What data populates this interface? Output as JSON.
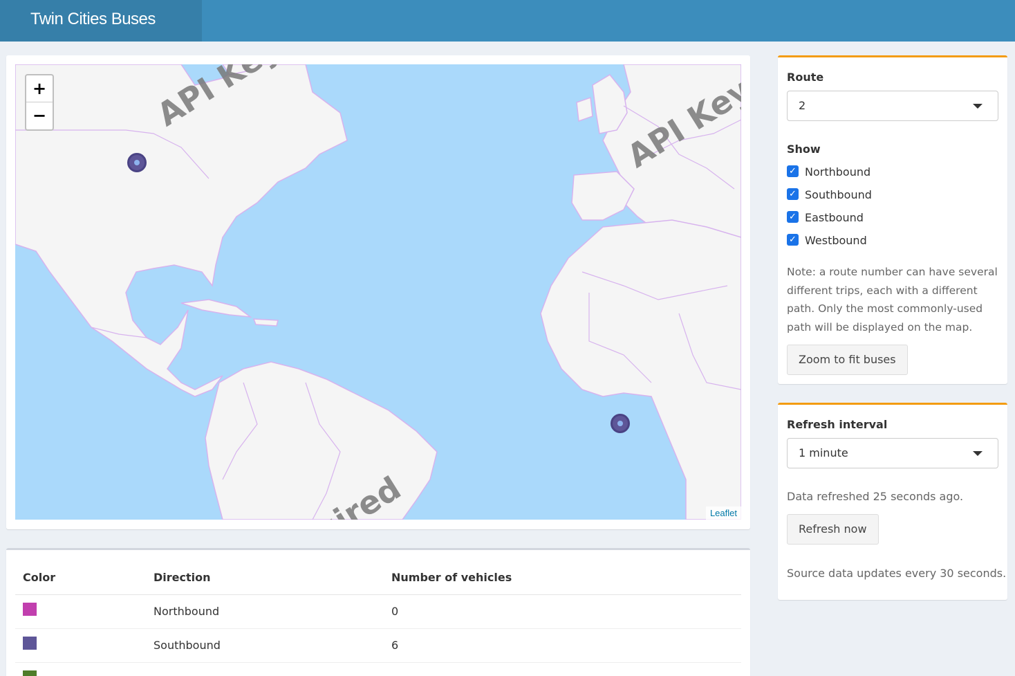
{
  "header": {
    "title": "Twin Cities Buses"
  },
  "map": {
    "zoom_in": "+",
    "zoom_out": "−",
    "attribution": "Leaflet",
    "watermarks": [
      "API Key Re",
      "API Key R",
      "quired"
    ],
    "marker_color": "#5e5698",
    "land_color": "#f5f5f5",
    "water_color": "#aad9fb",
    "border_color": "#d7b3ee"
  },
  "table": {
    "headers": [
      "Color",
      "Direction",
      "Number of vehicles"
    ],
    "rows": [
      {
        "color": "#c13fae",
        "direction": "Northbound",
        "count": "0"
      },
      {
        "color": "#5e5698",
        "direction": "Southbound",
        "count": "6"
      },
      {
        "color": "#4f7d2a",
        "direction": "",
        "count": ""
      }
    ]
  },
  "route_panel": {
    "route_label": "Route",
    "route_value": "2",
    "show_label": "Show",
    "checkboxes": [
      {
        "label": "Northbound",
        "checked": true
      },
      {
        "label": "Southbound",
        "checked": true
      },
      {
        "label": "Eastbound",
        "checked": true
      },
      {
        "label": "Westbound",
        "checked": true
      }
    ],
    "note": "Note: a route number can have several different trips, each with a different path. Only the most commonly-used path will be displayed on the map.",
    "zoom_button": "Zoom to fit buses"
  },
  "refresh_panel": {
    "label": "Refresh interval",
    "value": "1 minute",
    "status": "Data refreshed 25 seconds ago.",
    "button": "Refresh now",
    "footer": "Source data updates every 30 seconds."
  }
}
